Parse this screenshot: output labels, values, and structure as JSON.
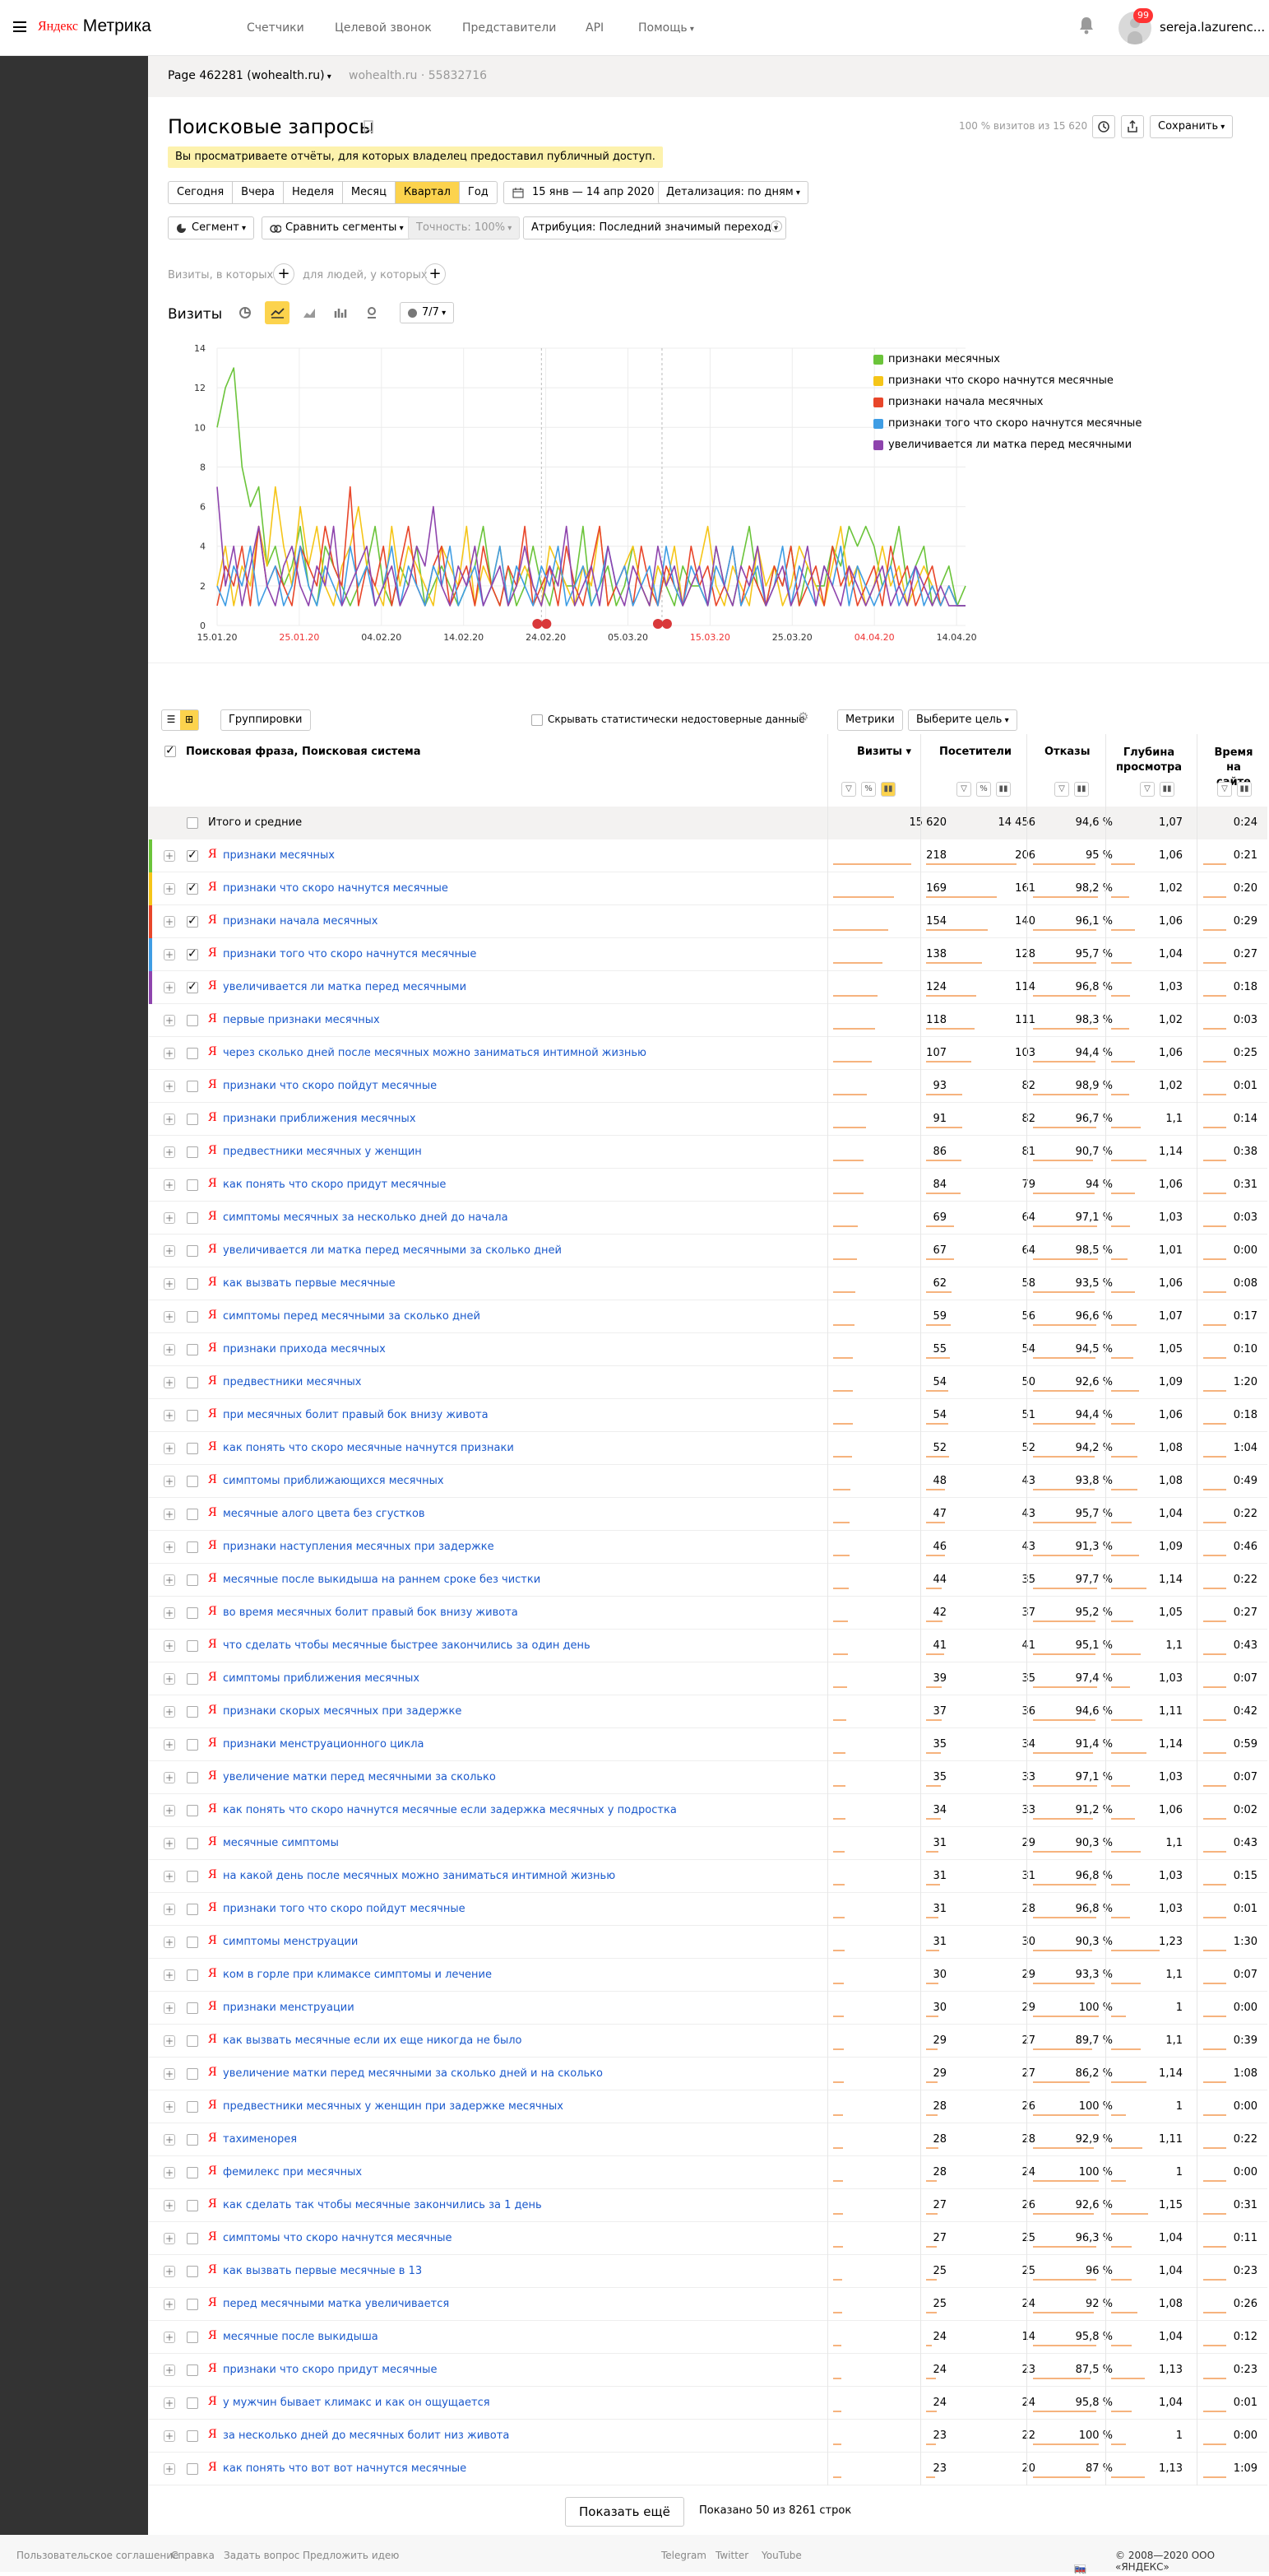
{
  "app": {
    "logo_ya": "Яндекс",
    "logo_rest": " Метрика",
    "nav": [
      "Счетчики",
      "Целевой звонок",
      "Представители",
      "API",
      "Помощь"
    ],
    "notifications": "99",
    "user": "sereja.lazurenc..."
  },
  "counter": {
    "name": "Page 462281 (wohealth.ru)",
    "host": "wohealth.ru · 55832716"
  },
  "report": {
    "title": "Поисковые запросы",
    "notice": "Вы просматриваете отчёты, для которых владелец предоставил публичный доступ.",
    "sample": "100 % визитов из 15 620",
    "save": "Сохранить"
  },
  "periods": [
    "Сегодня",
    "Вчера",
    "Неделя",
    "Месяц",
    "Квартал",
    "Год"
  ],
  "date_range": "15 янв — 14 апр 2020",
  "detail": "Детализация: по дням",
  "segment": "Сегмент",
  "compare": "Сравнить сегменты",
  "accuracy": "Точность: 100%",
  "attribution": "Атрибуция: Последний значимый переход",
  "filters": {
    "visits": "Визиты, в которых",
    "people": "для людей, у которых"
  },
  "chart_header": {
    "label": "Визиты",
    "series_count": "7/7"
  },
  "chart_data": {
    "type": "line",
    "ylim": [
      0,
      14
    ],
    "yticks": [
      0,
      2,
      4,
      6,
      8,
      10,
      12,
      14
    ],
    "xtick_labels": [
      "15.01.20",
      "25.01.20",
      "04.02.20",
      "14.02.20",
      "24.02.20",
      "05.03.20",
      "15.03.20",
      "25.03.20",
      "04.04.20",
      "14.04.20"
    ],
    "xtick_red": [
      false,
      true,
      false,
      false,
      false,
      false,
      true,
      false,
      true,
      false
    ],
    "series": [
      {
        "name": "признаки месячных",
        "color": "#6bc43a",
        "values": [
          10,
          12,
          13,
          8,
          6,
          7,
          3,
          4,
          2,
          3,
          5,
          2,
          1,
          4,
          3,
          2,
          1,
          2,
          3,
          5,
          2,
          1,
          3,
          2,
          4,
          1,
          2,
          3,
          2,
          1,
          2,
          3,
          5,
          2,
          1,
          3,
          1,
          2,
          4,
          2,
          1,
          3,
          2,
          2,
          5,
          1,
          2,
          3,
          1,
          2,
          4,
          2,
          1,
          3,
          2,
          1,
          3,
          2,
          2,
          1,
          4,
          2,
          1,
          3,
          5,
          2,
          1,
          3,
          2,
          4,
          1,
          3,
          2,
          2,
          4,
          3,
          5,
          4,
          5,
          4,
          2,
          3,
          5,
          2,
          3,
          4,
          1,
          2,
          3,
          1,
          2
        ]
      },
      {
        "name": "признаки что скоро начнутся месячные",
        "color": "#f5c518",
        "values": [
          2,
          4,
          1,
          3,
          2,
          5,
          3,
          7,
          4,
          2,
          6,
          3,
          5,
          2,
          1,
          3,
          4,
          6,
          3,
          2,
          1,
          5,
          2,
          4,
          3,
          2,
          1,
          4,
          3,
          2,
          5,
          1,
          3,
          2,
          4,
          1,
          2,
          3,
          2,
          1,
          4,
          3,
          2,
          1,
          3,
          2,
          5,
          1,
          2,
          3,
          4,
          2,
          1,
          3,
          2,
          4,
          1,
          2,
          3,
          5,
          2,
          1,
          3,
          2,
          1,
          4,
          2,
          3,
          1,
          2,
          4,
          3,
          2,
          1,
          3,
          5,
          2,
          3,
          1,
          2,
          4,
          2,
          3,
          1,
          2,
          3,
          2,
          1,
          2,
          1,
          1
        ]
      },
      {
        "name": "признаки начала месячных",
        "color": "#e8462a",
        "values": [
          1,
          3,
          2,
          4,
          1,
          5,
          2,
          3,
          2,
          1,
          4,
          3,
          2,
          5,
          3,
          2,
          7,
          1,
          3,
          2,
          4,
          1,
          3,
          5,
          2,
          1,
          3,
          4,
          1,
          2,
          3,
          1,
          4,
          2,
          1,
          3,
          2,
          5,
          1,
          2,
          3,
          1,
          4,
          2,
          1,
          3,
          5,
          1,
          2,
          3,
          1,
          4,
          2,
          1,
          3,
          2,
          1,
          4,
          2,
          3,
          1,
          2,
          4,
          1,
          3,
          2,
          1,
          3,
          2,
          4,
          1,
          2,
          3,
          1,
          4,
          2,
          3,
          1,
          2,
          3,
          1,
          4,
          2,
          3,
          1,
          2,
          3,
          1,
          2,
          1,
          1
        ]
      },
      {
        "name": "признаки того что скоро начнутся месячные",
        "color": "#3f9de4",
        "values": [
          2,
          1,
          3,
          2,
          4,
          1,
          2,
          3,
          1,
          2,
          4,
          2,
          1,
          3,
          2,
          1,
          4,
          2,
          3,
          1,
          2,
          4,
          1,
          3,
          2,
          1,
          3,
          2,
          4,
          1,
          2,
          3,
          1,
          2,
          4,
          1,
          3,
          2,
          1,
          3,
          2,
          4,
          1,
          2,
          3,
          1,
          2,
          4,
          2,
          3,
          1,
          2,
          3,
          1,
          4,
          2,
          1,
          3,
          2,
          1,
          3,
          2,
          4,
          1,
          2,
          3,
          1,
          2,
          4,
          1,
          3,
          2,
          1,
          3,
          2,
          4,
          1,
          3,
          2,
          1,
          2,
          3,
          1,
          2,
          3,
          1,
          2,
          1,
          2,
          1,
          1
        ]
      },
      {
        "name": "увеличивается ли матка перед месячными",
        "color": "#8e44ad",
        "values": [
          7,
          2,
          4,
          1,
          3,
          5,
          2,
          1,
          3,
          4,
          2,
          1,
          3,
          2,
          5,
          1,
          2,
          3,
          4,
          1,
          2,
          3,
          1,
          2,
          4,
          3,
          6,
          2,
          1,
          3,
          2,
          4,
          1,
          2,
          3,
          1,
          2,
          4,
          2,
          1,
          3,
          2,
          5,
          1,
          2,
          3,
          1,
          4,
          2,
          1,
          3,
          2,
          1,
          4,
          2,
          3,
          1,
          2,
          3,
          1,
          4,
          2,
          1,
          3,
          2,
          4,
          1,
          2,
          3,
          1,
          2,
          4,
          1,
          3,
          2,
          1,
          3,
          2,
          1,
          2,
          3,
          1,
          2,
          1,
          3,
          2,
          1,
          2,
          1,
          1,
          1
        ]
      }
    ]
  },
  "table_controls": {
    "groupings": "Группировки",
    "hide_unreliable": "Скрывать статистически недостоверные данные",
    "metrics": "Метрики",
    "goal": "Выберите цель"
  },
  "table_header": {
    "dim": "Поисковая фраза, Поисковая система",
    "visits": "Визиты",
    "visitors": "Посетители",
    "bounces": "Отказы",
    "depth": "Глубина просмотра",
    "time": "Время на сайте"
  },
  "totals": {
    "label": "Итого и средние",
    "visits": "15 620",
    "visitors": "14 456",
    "bounces": "94,6 %",
    "depth": "1,07",
    "time": "0:24"
  },
  "rows": [
    {
      "q": "признаки месячных",
      "v": "218",
      "p": "206",
      "b": "95 %",
      "d": "1,06",
      "t": "0:21",
      "chk": true,
      "color": "#6bc43a"
    },
    {
      "q": "признаки что скоро начнутся месячные",
      "v": "169",
      "p": "161",
      "b": "98,2 %",
      "d": "1,02",
      "t": "0:20",
      "chk": true,
      "color": "#f5c518"
    },
    {
      "q": "признаки начала месячных",
      "v": "154",
      "p": "140",
      "b": "96,1 %",
      "d": "1,06",
      "t": "0:29",
      "chk": true,
      "color": "#e8462a"
    },
    {
      "q": "признаки того что скоро начнутся месячные",
      "v": "138",
      "p": "128",
      "b": "95,7 %",
      "d": "1,04",
      "t": "0:27",
      "chk": true,
      "color": "#3f9de4"
    },
    {
      "q": "увеличивается ли матка перед месячными",
      "v": "124",
      "p": "114",
      "b": "96,8 %",
      "d": "1,03",
      "t": "0:18",
      "chk": true,
      "color": "#8e44ad"
    },
    {
      "q": "первые признаки месячных",
      "v": "118",
      "p": "111",
      "b": "98,3 %",
      "d": "1,02",
      "t": "0:03",
      "chk": false
    },
    {
      "q": "через сколько дней после месячных можно заниматься интимной жизнью",
      "v": "107",
      "p": "103",
      "b": "94,4 %",
      "d": "1,06",
      "t": "0:25",
      "chk": false
    },
    {
      "q": "признаки что скоро пойдут месячные",
      "v": "93",
      "p": "82",
      "b": "98,9 %",
      "d": "1,02",
      "t": "0:01",
      "chk": false
    },
    {
      "q": "признаки приближения месячных",
      "v": "91",
      "p": "82",
      "b": "96,7 %",
      "d": "1,1",
      "t": "0:14",
      "chk": false
    },
    {
      "q": "предвестники месячных у женщин",
      "v": "86",
      "p": "81",
      "b": "90,7 %",
      "d": "1,14",
      "t": "0:38",
      "chk": false
    },
    {
      "q": "как понять что скоро придут месячные",
      "v": "84",
      "p": "79",
      "b": "94 %",
      "d": "1,06",
      "t": "0:31",
      "chk": false
    },
    {
      "q": "симптомы месячных за несколько дней до начала",
      "v": "69",
      "p": "64",
      "b": "97,1 %",
      "d": "1,03",
      "t": "0:03",
      "chk": false
    },
    {
      "q": "увеличивается ли матка перед месячными за сколько дней",
      "v": "67",
      "p": "64",
      "b": "98,5 %",
      "d": "1,01",
      "t": "0:00",
      "chk": false
    },
    {
      "q": "как вызвать первые месячные",
      "v": "62",
      "p": "58",
      "b": "93,5 %",
      "d": "1,06",
      "t": "0:08",
      "chk": false
    },
    {
      "q": "симптомы перед месячными за сколько дней",
      "v": "59",
      "p": "56",
      "b": "96,6 %",
      "d": "1,07",
      "t": "0:17",
      "chk": false
    },
    {
      "q": "признаки прихода месячных",
      "v": "55",
      "p": "54",
      "b": "94,5 %",
      "d": "1,05",
      "t": "0:10",
      "chk": false
    },
    {
      "q": "предвестники месячных",
      "v": "54",
      "p": "50",
      "b": "92,6 %",
      "d": "1,09",
      "t": "1:20",
      "chk": false
    },
    {
      "q": "при месячных болит правый бок внизу живота",
      "v": "54",
      "p": "51",
      "b": "94,4 %",
      "d": "1,06",
      "t": "0:18",
      "chk": false
    },
    {
      "q": "как понять что скоро месячные начнутся признаки",
      "v": "52",
      "p": "52",
      "b": "94,2 %",
      "d": "1,08",
      "t": "1:04",
      "chk": false
    },
    {
      "q": "симптомы приближающихся месячных",
      "v": "48",
      "p": "43",
      "b": "93,8 %",
      "d": "1,08",
      "t": "0:49",
      "chk": false
    },
    {
      "q": "месячные алого цвета без сгустков",
      "v": "47",
      "p": "43",
      "b": "95,7 %",
      "d": "1,04",
      "t": "0:22",
      "chk": false
    },
    {
      "q": "признаки наступления месячных при задержке",
      "v": "46",
      "p": "43",
      "b": "91,3 %",
      "d": "1,09",
      "t": "0:46",
      "chk": false
    },
    {
      "q": "месячные после выкидыша на раннем сроке без чистки",
      "v": "44",
      "p": "35",
      "b": "97,7 %",
      "d": "1,14",
      "t": "0:22",
      "chk": false
    },
    {
      "q": "во время месячных болит правый бок внизу живота",
      "v": "42",
      "p": "37",
      "b": "95,2 %",
      "d": "1,05",
      "t": "0:27",
      "chk": false
    },
    {
      "q": "что сделать чтобы месячные быстрее закончились за один день",
      "v": "41",
      "p": "41",
      "b": "95,1 %",
      "d": "1,1",
      "t": "0:43",
      "chk": false
    },
    {
      "q": "симптомы приближения месячных",
      "v": "39",
      "p": "35",
      "b": "97,4 %",
      "d": "1,03",
      "t": "0:07",
      "chk": false
    },
    {
      "q": "признаки скорых месячных при задержке",
      "v": "37",
      "p": "36",
      "b": "94,6 %",
      "d": "1,11",
      "t": "0:42",
      "chk": false
    },
    {
      "q": "признаки менструационного цикла",
      "v": "35",
      "p": "34",
      "b": "91,4 %",
      "d": "1,14",
      "t": "0:59",
      "chk": false
    },
    {
      "q": "увеличение матки перед месячными за сколько",
      "v": "35",
      "p": "33",
      "b": "97,1 %",
      "d": "1,03",
      "t": "0:07",
      "chk": false
    },
    {
      "q": "как понять что скоро начнутся месячные если задержка месячных у подростка",
      "v": "34",
      "p": "33",
      "b": "91,2 %",
      "d": "1,06",
      "t": "0:02",
      "chk": false
    },
    {
      "q": "месячные симптомы",
      "v": "31",
      "p": "29",
      "b": "90,3 %",
      "d": "1,1",
      "t": "0:43",
      "chk": false
    },
    {
      "q": "на какой день после месячных можно заниматься интимной жизнью",
      "v": "31",
      "p": "31",
      "b": "96,8 %",
      "d": "1,03",
      "t": "0:15",
      "chk": false
    },
    {
      "q": "признаки того что скоро пойдут месячные",
      "v": "31",
      "p": "28",
      "b": "96,8 %",
      "d": "1,03",
      "t": "0:01",
      "chk": false
    },
    {
      "q": "симптомы менструации",
      "v": "31",
      "p": "30",
      "b": "90,3 %",
      "d": "1,23",
      "t": "1:30",
      "chk": false
    },
    {
      "q": "ком в горле при климаксе симптомы и лечение",
      "v": "30",
      "p": "29",
      "b": "93,3 %",
      "d": "1,1",
      "t": "0:07",
      "chk": false
    },
    {
      "q": "признаки менструации",
      "v": "30",
      "p": "29",
      "b": "100 %",
      "d": "1",
      "t": "0:00",
      "chk": false
    },
    {
      "q": "как вызвать месячные если их еще никогда не было",
      "v": "29",
      "p": "27",
      "b": "89,7 %",
      "d": "1,1",
      "t": "0:39",
      "chk": false
    },
    {
      "q": "увеличение матки перед месячными за сколько дней и на сколько",
      "v": "29",
      "p": "27",
      "b": "86,2 %",
      "d": "1,14",
      "t": "1:08",
      "chk": false
    },
    {
      "q": "предвестники месячных у женщин при задержке месячных",
      "v": "28",
      "p": "26",
      "b": "100 %",
      "d": "1",
      "t": "0:00",
      "chk": false
    },
    {
      "q": "тахименорея",
      "v": "28",
      "p": "28",
      "b": "92,9 %",
      "d": "1,11",
      "t": "0:22",
      "chk": false
    },
    {
      "q": "фемилекс при месячных",
      "v": "28",
      "p": "24",
      "b": "100 %",
      "d": "1",
      "t": "0:00",
      "chk": false
    },
    {
      "q": "как сделать так чтобы месячные закончились за 1 день",
      "v": "27",
      "p": "26",
      "b": "92,6 %",
      "d": "1,15",
      "t": "0:31",
      "chk": false
    },
    {
      "q": "симптомы что скоро начнутся месячные",
      "v": "27",
      "p": "25",
      "b": "96,3 %",
      "d": "1,04",
      "t": "0:11",
      "chk": false
    },
    {
      "q": "как вызвать первые месячные в 13",
      "v": "25",
      "p": "25",
      "b": "96 %",
      "d": "1,04",
      "t": "0:23",
      "chk": false
    },
    {
      "q": "перед месячными матка увеличивается",
      "v": "25",
      "p": "24",
      "b": "92 %",
      "d": "1,08",
      "t": "0:26",
      "chk": false
    },
    {
      "q": "месячные после выкидыша",
      "v": "24",
      "p": "14",
      "b": "95,8 %",
      "d": "1,04",
      "t": "0:12",
      "chk": false
    },
    {
      "q": "признаки что скоро придут месячные",
      "v": "24",
      "p": "23",
      "b": "87,5 %",
      "d": "1,13",
      "t": "0:23",
      "chk": false
    },
    {
      "q": "у мужчин бывает климакс и как он ощущается",
      "v": "24",
      "p": "24",
      "b": "95,8 %",
      "d": "1,04",
      "t": "0:01",
      "chk": false
    },
    {
      "q": "за несколько дней до месячных болит низ живота",
      "v": "23",
      "p": "22",
      "b": "100 %",
      "d": "1",
      "t": "0:00",
      "chk": false
    },
    {
      "q": "как понять что вот вот начнутся месячные",
      "v": "23",
      "p": "20",
      "b": "87 %",
      "d": "1,13",
      "t": "1:09",
      "chk": false
    }
  ],
  "show_more": "Показать ещё",
  "shown": "Показано 50 из 8261 строк",
  "footer": {
    "links": [
      "Пользовательское соглашение",
      "Справка",
      "Задать вопрос",
      "Предложить идею"
    ],
    "social": [
      "Telegram",
      "Twitter",
      "YouTube"
    ],
    "lang": "Ru",
    "copyright": "© 2008—2020 ООО «ЯНДЕКС»"
  }
}
